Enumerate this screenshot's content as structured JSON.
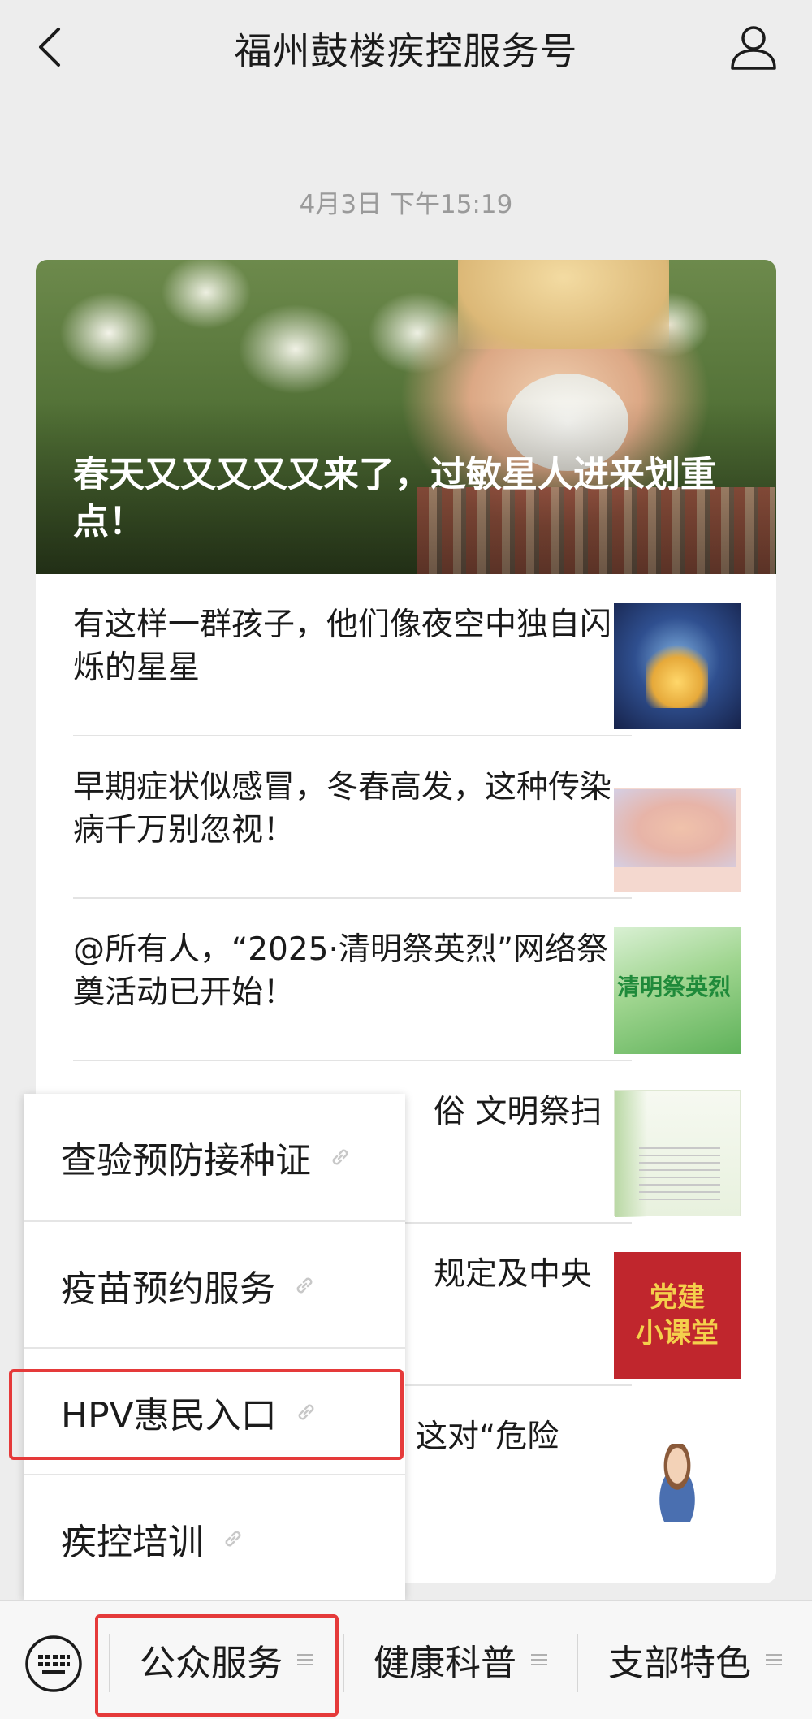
{
  "header": {
    "title": "福州鼓楼疾控服务号",
    "back_icon": "chevron-left-icon",
    "profile_icon": "person-icon"
  },
  "timestamp": "4月3日 下午15:19",
  "hero": {
    "title": "春天又又又又又来了，过敏星人进来划重点！"
  },
  "articles": [
    {
      "title": "有这样一群孩子，他们像夜空中独自闪烁的星星"
    },
    {
      "title": "早期症状似感冒，冬春高发，这种传染病千万别忽视！"
    },
    {
      "title": "@所有人，“2025·清明祭英烈”网络祭奠活动已开始！"
    },
    {
      "title": "俗 文明祭扫"
    },
    {
      "title": "规定及中央",
      "thumb_text": [
        "党建",
        "小课堂"
      ]
    },
    {
      "title": "这对“危险"
    }
  ],
  "popup_menu": {
    "items": [
      {
        "label": "查验预防接种证"
      },
      {
        "label": "疫苗预约服务"
      },
      {
        "label": "HPV惠民入口",
        "highlighted": true
      },
      {
        "label": "疾控培训"
      }
    ]
  },
  "bottom_menu": {
    "tabs": [
      {
        "label": "公众服务",
        "active": true
      },
      {
        "label": "健康科普"
      },
      {
        "label": "支部特色"
      }
    ]
  },
  "colors": {
    "background": "#ededed",
    "card": "#ffffff",
    "highlight": "#e53a3a",
    "timestamp": "#9a9a9a"
  }
}
